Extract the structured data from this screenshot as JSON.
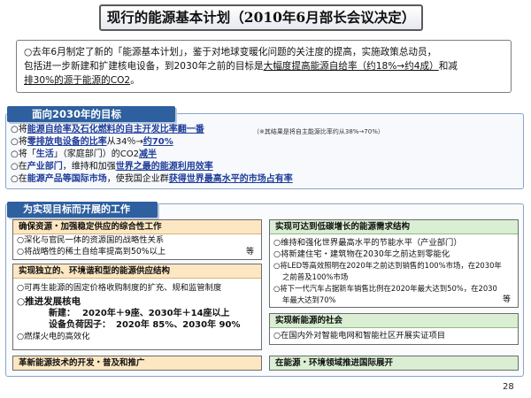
{
  "title": "现行的能源基本计划（2010年6月部长会议决定）",
  "intro": {
    "line1": "○去年6月制定了新的「能源基本计划」，鉴于对地球变暖化问题的关注度的提高，实施政策总动员，",
    "line2a": "包括进一步新建和扩建核电设备，到2030年之前的目标是",
    "line2u": "大幅度提高能源自给率（约18%→约4成）",
    "line2b": "和减",
    "line3u": "排30%的源于能源的CO2",
    "line3b": "。"
  },
  "goals": {
    "title": "面向2030年的目标",
    "note": "（※其结果是将自主能源比率约从38%→70%）",
    "g1a": "○将",
    "g1b": "能源自给率及石化燃料的自主开发比率翻一番",
    "g2a": "○将",
    "g2b": "零排放电设备的比率",
    "g2c": "从34％→",
    "g2d": "约70%",
    "g3a": "○将「",
    "g3b": "生活",
    "g3c": "」（家庭部门）的CO2",
    "g3d": "减半",
    "g4a": "○在",
    "g4b": "产业部门",
    "g4c": "，维持和加强",
    "g4d": "世界之最的能源利用效率",
    "g5a": "○在",
    "g5b": "能源产品等国际市场",
    "g5c": "，使我国企业群",
    "g5d": "获得世界最高水平的市场占有率"
  },
  "plans": {
    "title": "为实现目标而开展的工作",
    "supply": {
      "header": "确保资源・加强稳定供应的综合性工作",
      "items": [
        "○深化与官民一体的资源国的战略性关系",
        "○将战略性的稀土自给率提高到50%以上"
      ],
      "etc": "等"
    },
    "independent": {
      "header": "实现独立的、环境谐和型的能源供应结构",
      "item1": "○可再生能源的固定价格收购制度的扩充、规和监管制度",
      "nuclear_title": "○推进发展核电",
      "new_label": "新建：",
      "new_value": "2020年＋9座、2030年＋14座以上",
      "cf_label": "设备负荷因子：",
      "cf_value": "2020年 85%、2030年 90%",
      "item_last": "○燃煤火电的高效化"
    },
    "tech": {
      "header": "革新能源技术的开发・普及和推广"
    },
    "demand": {
      "header": "实现可达到低碳增长的能源需求结构",
      "items": [
        "○维持和强化世界最高水平的节能水平（产业部门）",
        "○将新建住宅・建筑物在2030年之前达到零能化",
        "○将LED等高效照明在2020年之前达到销售的100%市场，在2030年",
        "之前普及100%市场",
        "○将下一代汽车占据新车销售比例在2020年最大达到50%，在2030",
        "年最大达到70%"
      ],
      "etc": "等"
    },
    "society": {
      "header": "实现新能源的社会",
      "items": [
        "○在国内外对智能电网和智能社区开展实证项目"
      ]
    },
    "intl": {
      "header": "在能源・环境领域推进国际展开"
    }
  },
  "page_number": "28"
}
